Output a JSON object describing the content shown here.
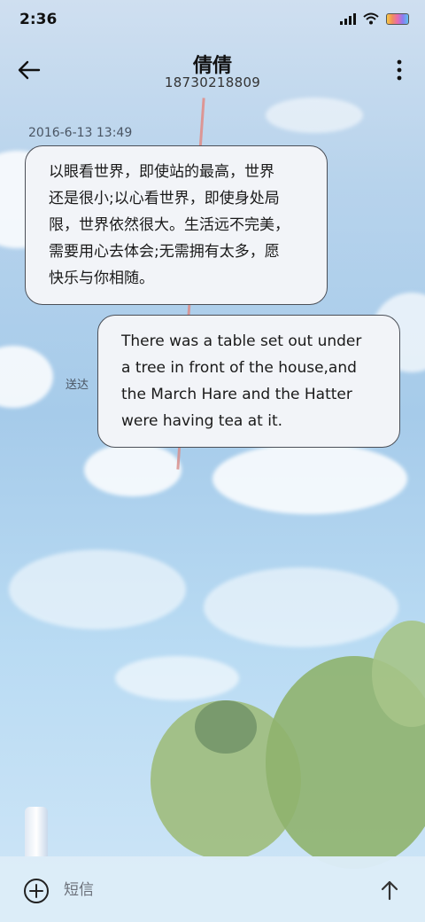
{
  "statusbar": {
    "time": "2:36",
    "icons": [
      "signal-icon",
      "wifi-icon",
      "battery-icon"
    ]
  },
  "header": {
    "title": "倩倩",
    "phone": "18730218809",
    "back_icon": "arrow-left-icon",
    "more_icon": "more-vertical-icon"
  },
  "conversation": {
    "timestamp": "2016-6-13 13:49",
    "messages": [
      {
        "direction": "incoming",
        "text": "以眼看世界，即使站的最高，世界\n还是很小;以心看世界，即使身处局\n限，世界依然很大。生活远不完美，\n需要用心去体会;无需拥有太多，愿\n快乐与你相随。"
      },
      {
        "direction": "outgoing",
        "text": "There was a table set out under\na tree in front of the house,and\nthe March Hare and the Hatter\nwere having tea at it.",
        "status": "送达"
      }
    ]
  },
  "composer": {
    "placeholder": "短信",
    "add_icon": "add-circle-icon",
    "send_icon": "arrow-up-icon"
  },
  "colors": {
    "bubble_bg": "#f2f4f8",
    "bubble_border": "#4b4f57",
    "sky_top": "#cfdff0",
    "sky_mid": "#a6cbea"
  }
}
